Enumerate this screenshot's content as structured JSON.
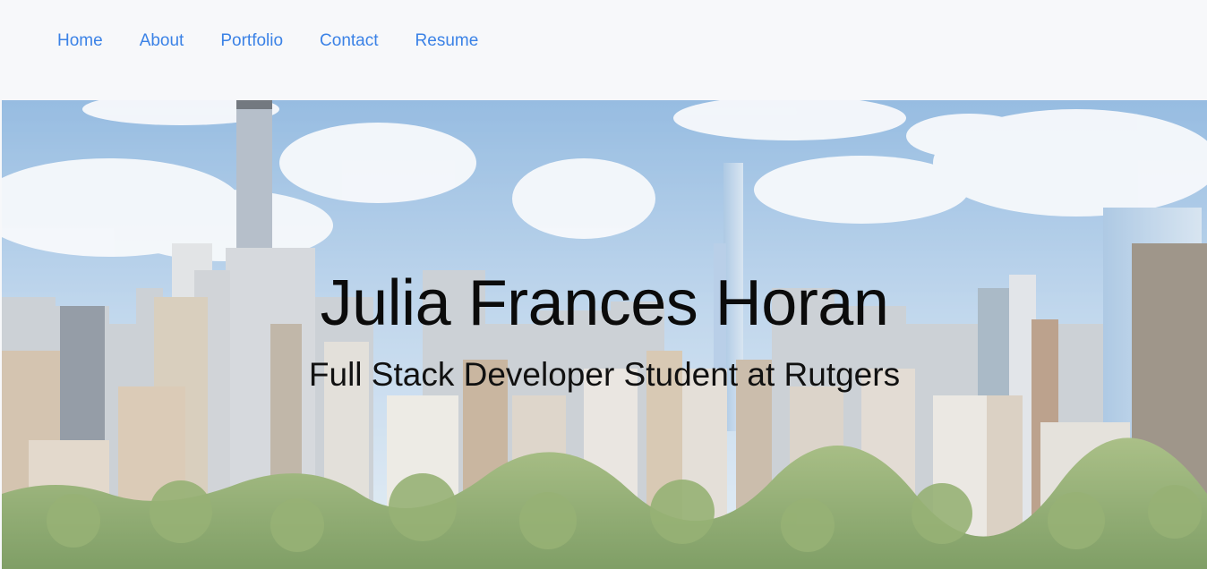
{
  "nav": {
    "items": [
      {
        "label": "Home"
      },
      {
        "label": "About"
      },
      {
        "label": "Portfolio"
      },
      {
        "label": "Contact"
      },
      {
        "label": "Resume"
      }
    ]
  },
  "hero": {
    "title": "Julia Frances Horan",
    "subtitle": "Full Stack Developer Student at Rutgers",
    "background": "city-skyline-park-photo"
  },
  "colors": {
    "nav_link": "#3b82e6",
    "nav_bg": "#f7f8fa",
    "title": "#0b0b0b"
  }
}
